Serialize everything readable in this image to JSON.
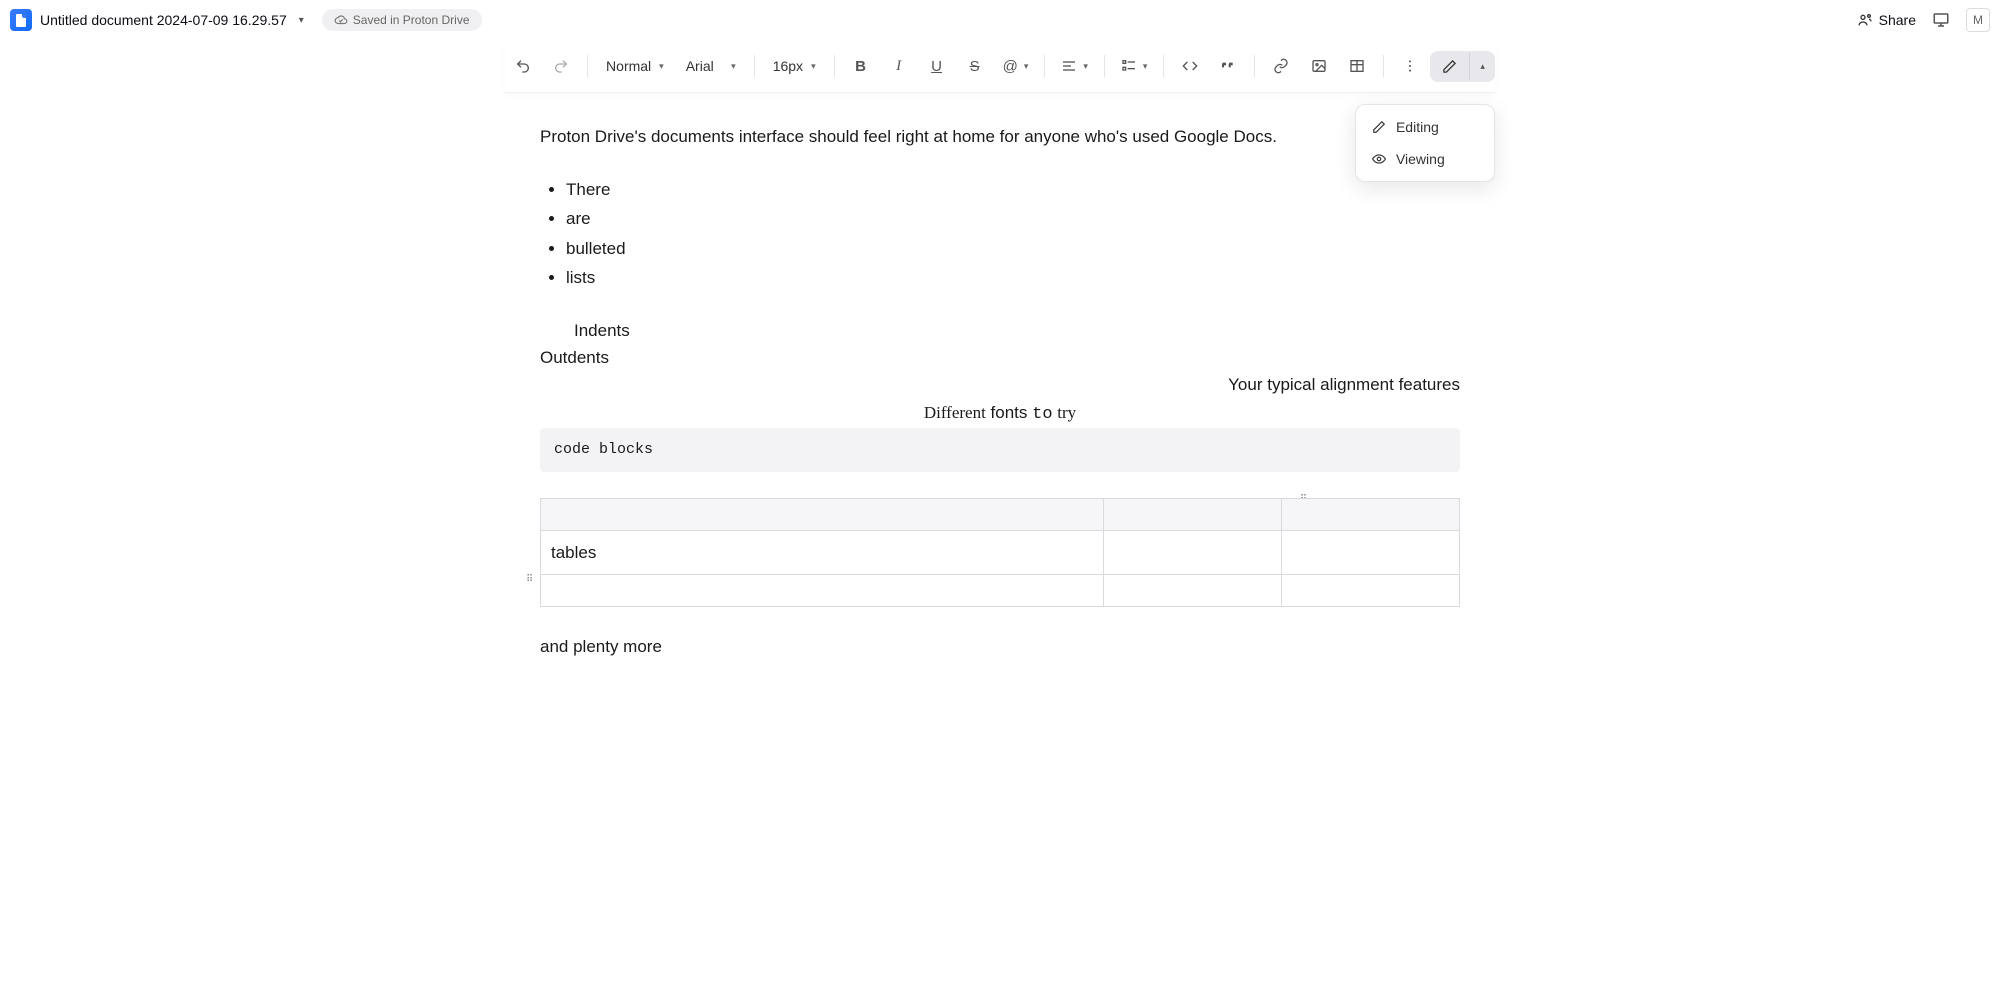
{
  "header": {
    "doc_title": "Untitled document 2024-07-09 16.29.57",
    "save_status": "Saved in Proton Drive",
    "share_label": "Share",
    "avatar_initial": "M"
  },
  "toolbar": {
    "style_select": "Normal",
    "font_select": "Arial",
    "size_select": "16px"
  },
  "mode_menu": {
    "editing": "Editing",
    "viewing": "Viewing"
  },
  "document": {
    "intro": "Proton Drive's documents interface should feel right at home for anyone who's used Google Docs.",
    "bullets": [
      "There",
      "are",
      "bulleted",
      "lists"
    ],
    "indent_text": "Indents",
    "outdent_text": "Outdents",
    "right_align": "Your typical alignment features",
    "fonts": {
      "w1": "Different",
      "w2": "fonts",
      "w3": "to",
      "w4": "try"
    },
    "code": "code blocks",
    "table_cell": "tables",
    "closing": "and plenty more"
  }
}
